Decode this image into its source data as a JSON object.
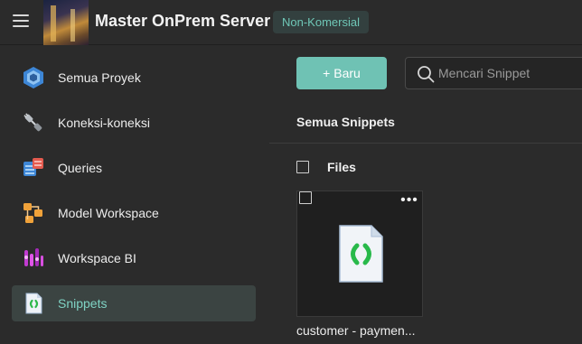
{
  "header": {
    "title": "Master OnPrem Server",
    "badge": "Non-Komersial",
    "menu_icon": "hamburger-icon"
  },
  "sidebar": {
    "items": [
      {
        "label": "Semua Proyek",
        "icon": "projects-hexagon-icon",
        "active": false
      },
      {
        "label": "Koneksi-koneksi",
        "icon": "plug-connection-icon",
        "active": false
      },
      {
        "label": "Queries",
        "icon": "queries-table-icon",
        "active": false
      },
      {
        "label": "Model Workspace",
        "icon": "model-workspace-icon",
        "active": false
      },
      {
        "label": "Workspace BI",
        "icon": "workspace-bi-icon",
        "active": false
      },
      {
        "label": "Snippets",
        "icon": "snippet-file-icon",
        "active": true
      }
    ]
  },
  "main": {
    "new_button": "+ Baru",
    "search": {
      "placeholder": "Mencari Snippet",
      "value": ""
    },
    "section_title": "Semua Snippets",
    "files_label": "Files",
    "files": [
      {
        "name": "customer - paymen...",
        "icon": "snippet-file-icon"
      }
    ]
  },
  "colors": {
    "accent": "#6fc2b4",
    "badge_text": "#6fc7b7",
    "active_bg": "#3b4442",
    "background": "#2b2b2b"
  }
}
